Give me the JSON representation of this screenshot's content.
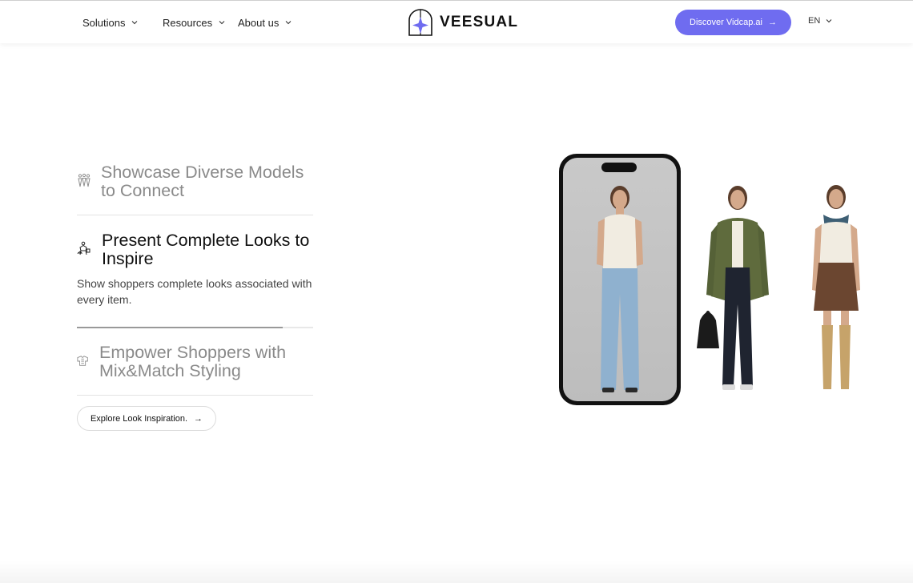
{
  "nav": {
    "solutions": "Solutions",
    "resources": "Resources",
    "about": "About us",
    "logo_text": "VEESUAL",
    "cta": "Discover Vidcap.ai",
    "lang": "EN"
  },
  "features": [
    {
      "title": "Showcase Diverse Models to Connect",
      "state": "collapsed"
    },
    {
      "title": "Present Complete Looks to Inspire",
      "description": "Show shoppers complete looks associated with every item.",
      "state": "expanded"
    },
    {
      "title": "Empower Shoppers with Mix&Match Styling",
      "state": "collapsed"
    }
  ],
  "progress": 0.87,
  "explore_button": "Explore Look Inspiration.",
  "colors": {
    "accent": "#6f6cf0",
    "muted_text": "#8a8a8a"
  },
  "icons": [
    "chevron-down-icon",
    "arrow-right-icon",
    "models-icon",
    "looks-icon",
    "mix-match-icon",
    "veesual-logo-icon"
  ]
}
